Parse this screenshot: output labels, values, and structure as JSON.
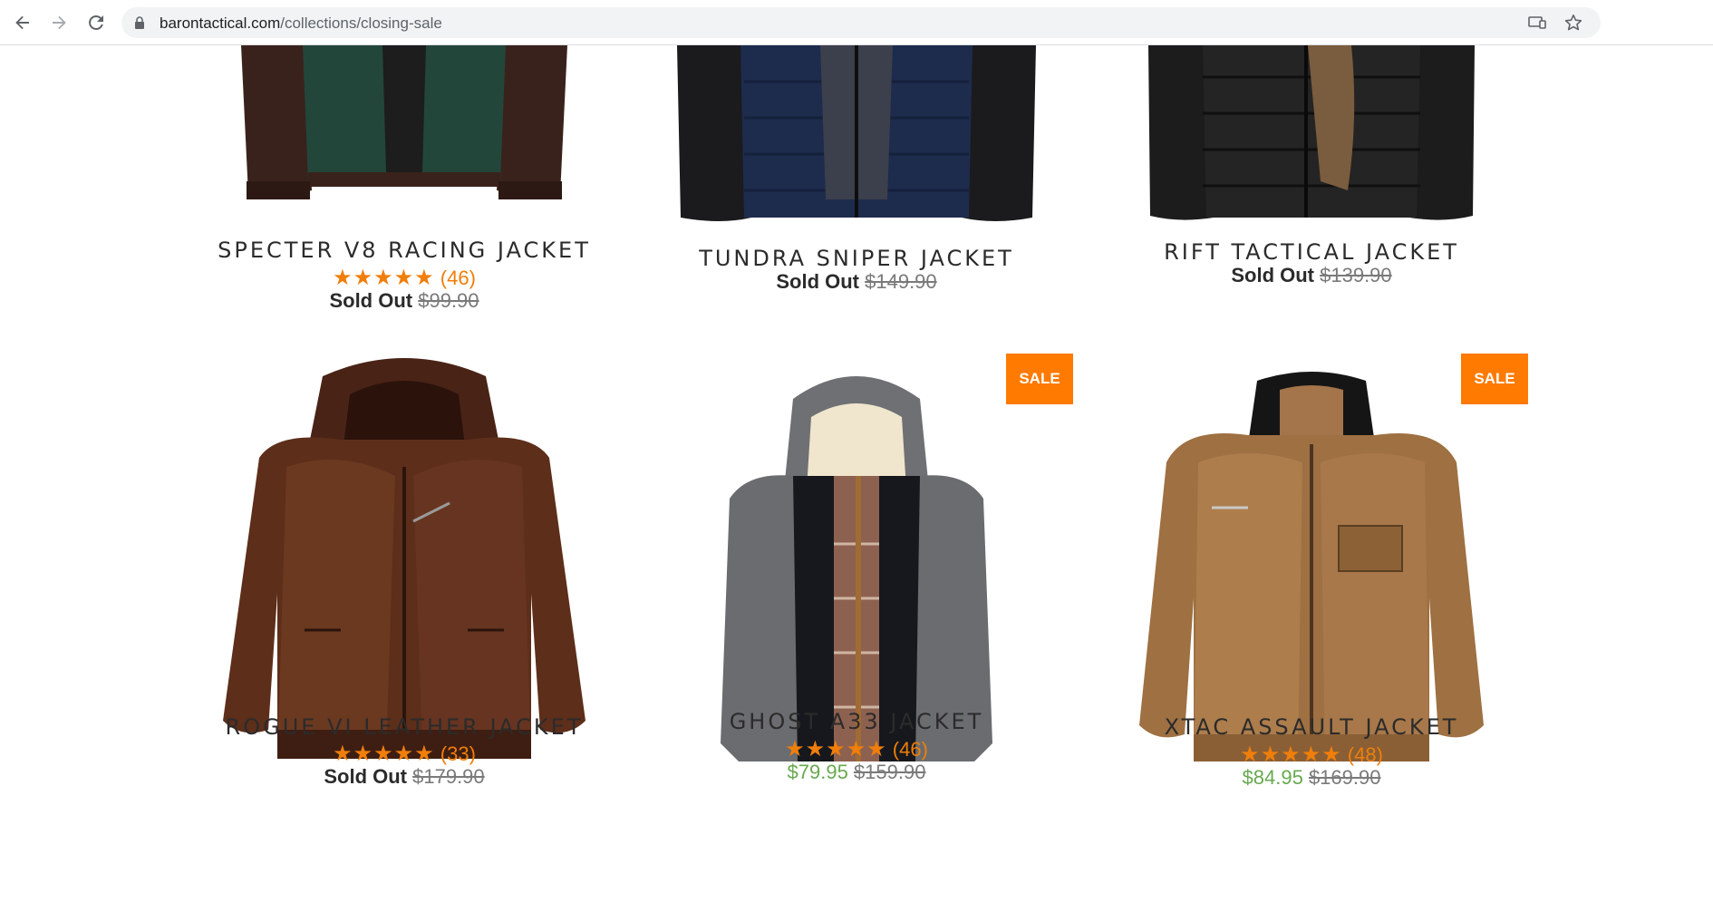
{
  "browser": {
    "url_host": "barontactical.com",
    "url_path": "/collections/closing-sale"
  },
  "colors": {
    "accent_orange": "#ff7a00",
    "star_orange": "#f07e0a",
    "sale_green": "#67a94f"
  },
  "products": [
    {
      "title": "SPECTER V8 RACING JACKET",
      "stars": "★★★★★",
      "reviews": "(46)",
      "status": "Sold Out",
      "sale_price": "",
      "old_price": "$99.90",
      "badge": "",
      "image": "green-racing-jacket"
    },
    {
      "title": "TUNDRA SNIPER JACKET",
      "stars": "",
      "reviews": "",
      "status": "Sold Out",
      "sale_price": "",
      "old_price": "$149.90",
      "badge": "",
      "image": "navy-puffer-jacket"
    },
    {
      "title": "RIFT TACTICAL JACKET",
      "stars": "",
      "reviews": "",
      "status": "Sold Out",
      "sale_price": "",
      "old_price": "$139.90",
      "badge": "",
      "image": "black-puffer-jacket"
    },
    {
      "title": "ROGUE VI LEATHER JACKET",
      "stars": "★★★★★",
      "reviews": "(33)",
      "status": "Sold Out",
      "sale_price": "",
      "old_price": "$179.90",
      "badge": "",
      "image": "brown-leather-hooded-jacket"
    },
    {
      "title": "GHOST A33 JACKET",
      "stars": "★★★★★",
      "reviews": "(46)",
      "status": "",
      "sale_price": "$79.95",
      "old_price": "$159.90",
      "badge": "SALE",
      "image": "black-grey-hooded-puffer-jacket"
    },
    {
      "title": "XTAC ASSAULT JACKET",
      "stars": "★★★★★",
      "reviews": "(48)",
      "status": "",
      "sale_price": "$84.95",
      "old_price": "$169.90",
      "badge": "SALE",
      "image": "tan-leather-jacket"
    }
  ]
}
